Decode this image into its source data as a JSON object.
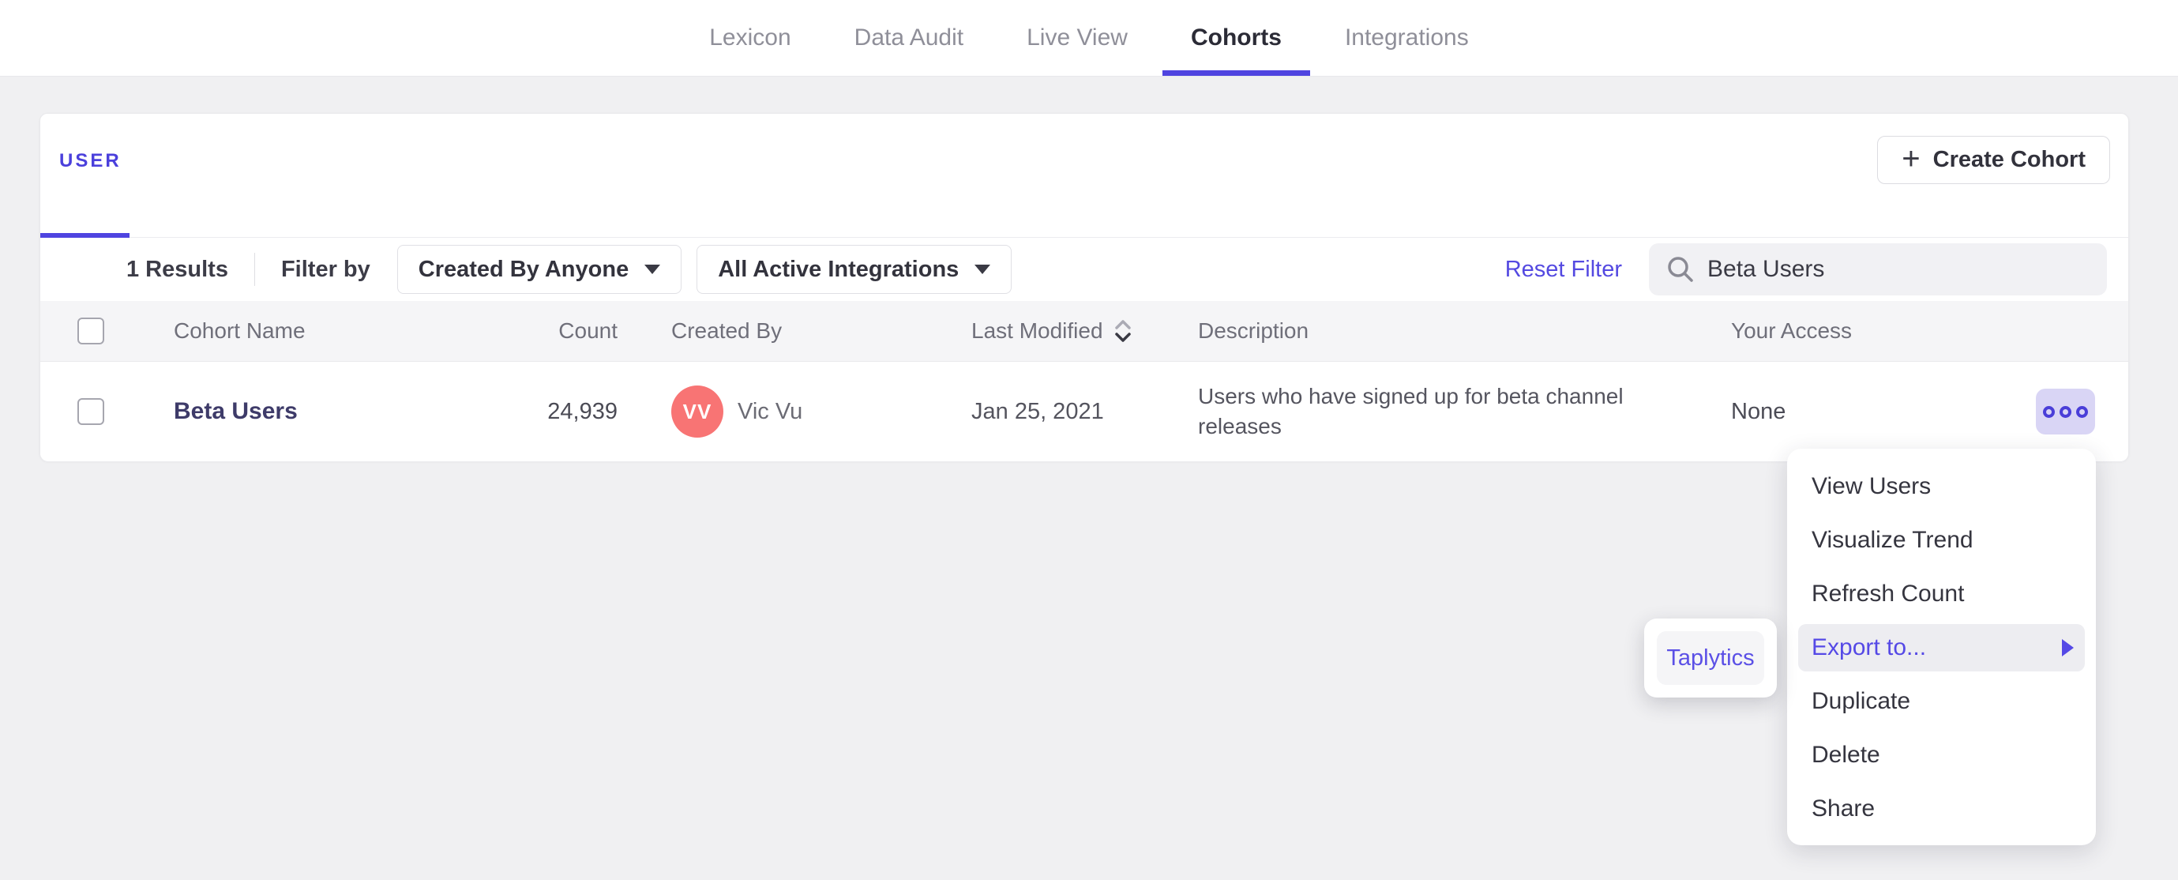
{
  "nav": {
    "tabs": [
      {
        "label": "Lexicon",
        "active": false
      },
      {
        "label": "Data Audit",
        "active": false
      },
      {
        "label": "Live View",
        "active": false
      },
      {
        "label": "Cohorts",
        "active": true
      },
      {
        "label": "Integrations",
        "active": false
      }
    ]
  },
  "cohorts_panel": {
    "type_tab": "USER",
    "create_button": {
      "label": "Create Cohort",
      "icon": "+"
    },
    "filter_bar": {
      "results_count": "1 Results",
      "filter_by_label": "Filter by",
      "created_by_filter": "Created By Anyone",
      "integrations_filter": "All Active Integrations",
      "reset_filter": "Reset Filter",
      "search_value": "Beta Users"
    },
    "table": {
      "headers": {
        "cohort_name": "Cohort Name",
        "count": "Count",
        "created_by": "Created By",
        "last_modified": "Last Modified",
        "description": "Description",
        "your_access": "Your Access"
      },
      "rows": [
        {
          "cohort_name": "Beta Users",
          "count": "24,939",
          "creator_initials": "VV",
          "creator_name": "Vic Vu",
          "last_modified": "Jan 25, 2021",
          "description": "Users who have signed up for beta channel releases",
          "your_access": "None"
        }
      ]
    }
  },
  "context_menu": {
    "items": [
      "View Users",
      "Visualize Trend",
      "Refresh Count",
      "Export to...",
      "Duplicate",
      "Delete",
      "Share"
    ],
    "highlighted_item": "Export to...",
    "submenu": {
      "items": [
        "Taplytics"
      ],
      "highlighted_item": "Taplytics"
    }
  },
  "colors": {
    "accent": "#4F44E0",
    "link_purple": "#5449E1",
    "avatar_coral": "#F87474",
    "highlight_bg": "#EDEDF1",
    "more_button_bg": "#D9D5F5"
  }
}
